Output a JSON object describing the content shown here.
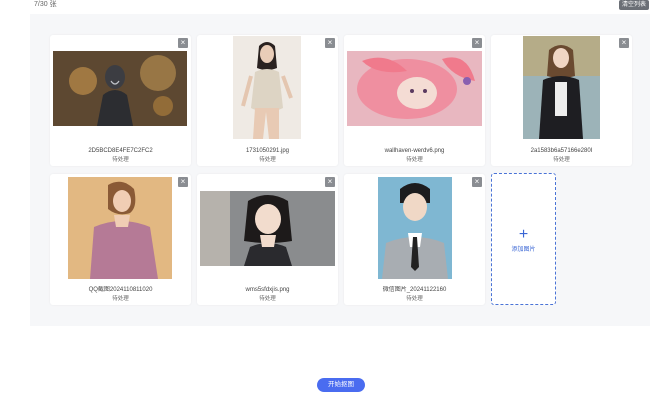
{
  "header": {
    "count_text": "7/30 张",
    "clear_label": "清空列表"
  },
  "images": [
    {
      "filename": "2D5BCD8E4FE7C2FC2",
      "status": "待处理",
      "subject": "robot-woman-sparks"
    },
    {
      "filename": "1731050291.jpg",
      "status": "待处理",
      "subject": "woman-white-swimsuit"
    },
    {
      "filename": "wallhaven-werdv6.png",
      "status": "待处理",
      "subject": "anime-pink-hair"
    },
    {
      "filename": "2a1583b6a57166e280I",
      "status": "待处理",
      "subject": "woman-dark-cardigan"
    },
    {
      "filename": "QQ截图2024110811020",
      "status": "待处理",
      "subject": "woman-pink-sweater"
    },
    {
      "filename": "wms5sfdxjis.png",
      "status": "待处理",
      "subject": "woman-bob-hair"
    },
    {
      "filename": "微信图片_20241122160",
      "status": "待处理",
      "subject": "man-suit-portrait"
    }
  ],
  "add_card": {
    "label": "添加图片",
    "icon": "plus-icon"
  },
  "actions": {
    "start_label": "开始抠图"
  },
  "colors": {
    "accent": "#4a6cf0",
    "panel_bg": "#f6f7f9",
    "close_bg": "#8a8d92"
  }
}
